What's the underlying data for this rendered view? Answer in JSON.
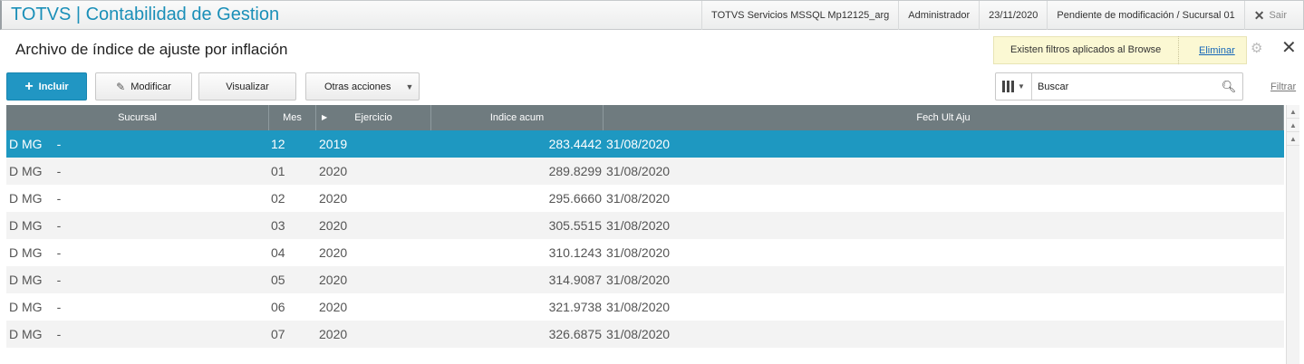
{
  "header": {
    "app_title": "TOTVS | Contabilidad de Gestion",
    "environment": "TOTVS Servicios MSSQL Mp12125_arg",
    "user": "Administrador",
    "date": "23/11/2020",
    "branch_status": "Pendiente de modificación / Sucursal 01",
    "exit_label": "Sair"
  },
  "page": {
    "title": "Archivo de índice de ajuste por inflación"
  },
  "filter_notice": {
    "message": "Existen filtros aplicados al Browse",
    "remove_label": "Eliminar"
  },
  "toolbar": {
    "include_label": "Incluir",
    "modify_label": "Modificar",
    "view_label": "Visualizar",
    "other_actions_label": "Otras acciones"
  },
  "search": {
    "placeholder": "Buscar",
    "filter_label": "Filtrar"
  },
  "grid": {
    "columns": [
      "Sucursal",
      "Mes",
      "Ejercicio",
      "Indice acum",
      "Fech Ult Aju"
    ],
    "rows": [
      {
        "sucursal": "D MG",
        "dash": "-",
        "mes": "12",
        "ejercicio": "2019",
        "indice": "283.4442",
        "fecha": "31/08/2020",
        "selected": true
      },
      {
        "sucursal": "D MG",
        "dash": "-",
        "mes": "01",
        "ejercicio": "2020",
        "indice": "289.8299",
        "fecha": "31/08/2020"
      },
      {
        "sucursal": "D MG",
        "dash": "-",
        "mes": "02",
        "ejercicio": "2020",
        "indice": "295.6660",
        "fecha": "31/08/2020"
      },
      {
        "sucursal": "D MG",
        "dash": "-",
        "mes": "03",
        "ejercicio": "2020",
        "indice": "305.5515",
        "fecha": "31/08/2020"
      },
      {
        "sucursal": "D MG",
        "dash": "-",
        "mes": "04",
        "ejercicio": "2020",
        "indice": "310.1243",
        "fecha": "31/08/2020"
      },
      {
        "sucursal": "D MG",
        "dash": "-",
        "mes": "05",
        "ejercicio": "2020",
        "indice": "314.9087",
        "fecha": "31/08/2020"
      },
      {
        "sucursal": "D MG",
        "dash": "-",
        "mes": "06",
        "ejercicio": "2020",
        "indice": "321.9738",
        "fecha": "31/08/2020"
      },
      {
        "sucursal": "D MG",
        "dash": "-",
        "mes": "07",
        "ejercicio": "2020",
        "indice": "326.6875",
        "fecha": "31/08/2020"
      }
    ]
  },
  "colors": {
    "brand": "#1a8fb8",
    "primary_button": "#2196c3",
    "selected_row": "#1e98c1",
    "grid_header": "#6f7b7f",
    "filter_notice_bg": "#fbf8d3"
  }
}
